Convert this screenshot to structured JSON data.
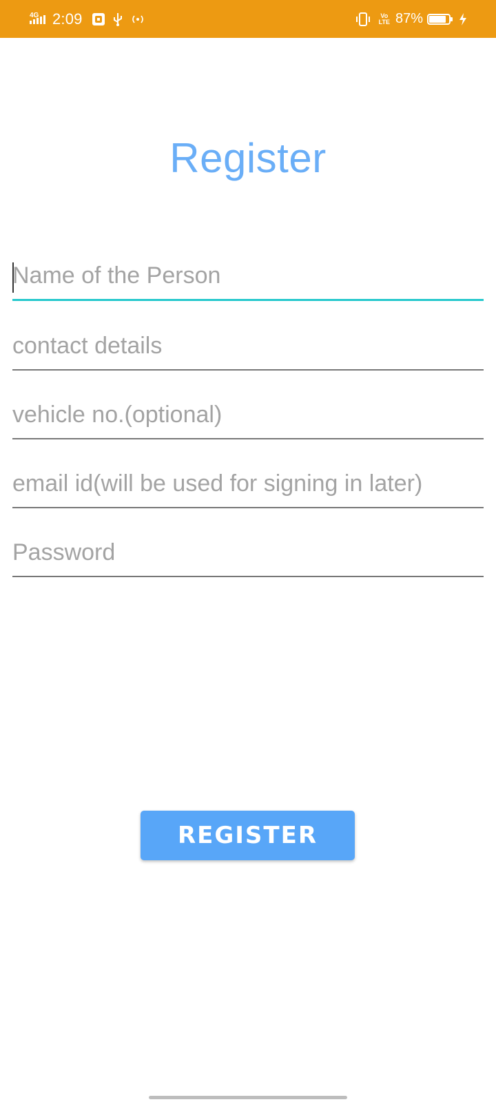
{
  "status_bar": {
    "network_type": "4G",
    "time": "2:09",
    "volte_line1": "Vo",
    "volte_line2": "LTE",
    "battery_percent": "87%",
    "battery_level": 0.87,
    "background_color": "#ED9A12"
  },
  "page": {
    "title": "Register",
    "title_color": "#6AAEF7"
  },
  "form": {
    "name_placeholder": "Name of the Person",
    "contact_placeholder": "contact details",
    "vehicle_placeholder": "vehicle no.(optional)",
    "email_placeholder": "email id(will be used for signing in later)",
    "password_placeholder": "Password",
    "focus_color": "#24C8CC"
  },
  "register_button": {
    "label": "REGISTER",
    "color": "#58A6F8"
  },
  "icons": {
    "signal": "signal-icon",
    "usb_debug": "usb-debug-icon",
    "usb": "usb-icon",
    "hotspot": "hotspot-icon",
    "vibrate": "vibrate-icon",
    "battery": "battery-icon",
    "charging": "charging-icon"
  }
}
